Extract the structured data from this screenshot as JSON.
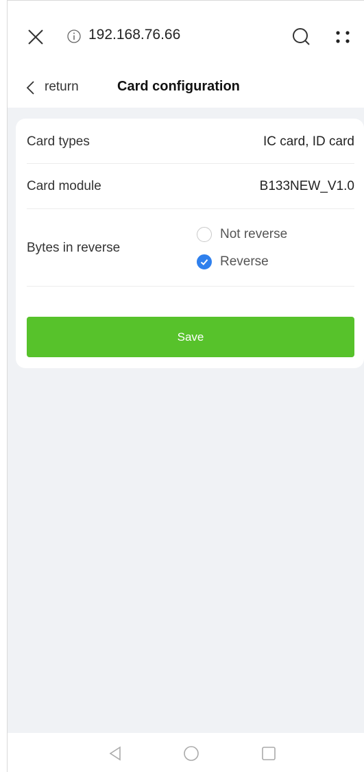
{
  "browser": {
    "url": "192.168.76.66",
    "icons": [
      "close-icon",
      "info-icon",
      "search-icon",
      "more-icon"
    ]
  },
  "header": {
    "back_label": "return",
    "title": "Card configuration"
  },
  "settings": {
    "card_types": {
      "label": "Card types",
      "value": "IC card, ID card"
    },
    "card_module": {
      "label": "Card module",
      "value": "B133NEW_V1.0"
    },
    "bytes_reverse": {
      "label": "Bytes in reverse",
      "options": [
        {
          "label": "Not reverse",
          "selected": false
        },
        {
          "label": "Reverse",
          "selected": true
        }
      ]
    }
  },
  "actions": {
    "save_label": "Save"
  },
  "colors": {
    "accent_green": "#57c22b",
    "radio_blue": "#2f80ed",
    "background": "#f0f2f5"
  }
}
